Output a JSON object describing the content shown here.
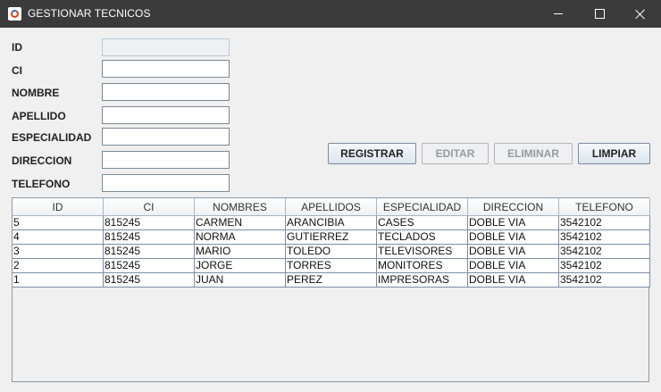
{
  "window": {
    "title": "GESTIONAR TECNICOS"
  },
  "form": {
    "labels": [
      "ID",
      "CI",
      "NOMBRE",
      "APELLIDO",
      "ESPECIALIDAD",
      "DIRECCION",
      "TELEFONO"
    ],
    "values": {
      "id": "",
      "ci": "",
      "nombre": "",
      "apellido": "",
      "especialidad": "",
      "direccion": "",
      "telefono": ""
    }
  },
  "buttons": {
    "registrar": "REGISTRAR",
    "editar": "EDITAR",
    "eliminar": "ELIMINAR",
    "limpiar": "LIMPIAR"
  },
  "table": {
    "columns": [
      "ID",
      "CI",
      "NOMBRES",
      "APELLIDOS",
      "ESPECIALIDAD",
      "DIRECCION",
      "TELEFONO"
    ],
    "rows": [
      [
        "5",
        "815245",
        "CARMEN",
        "ARANCIBIA",
        "CASES",
        "DOBLE VIA",
        "3542102"
      ],
      [
        "4",
        "815245",
        "NORMA",
        "GUTIERREZ",
        "TECLADOS",
        "DOBLE VIA",
        "3542102"
      ],
      [
        "3",
        "815245",
        "MARIO",
        "TOLEDO",
        "TELEVISORES",
        "DOBLE VIA",
        "3542102"
      ],
      [
        "2",
        "815245",
        "JORGE",
        "TORRES",
        "MONITORES",
        "DOBLE VIA",
        "3542102"
      ],
      [
        "1",
        "815245",
        "JUAN",
        "PEREZ",
        "IMPRESORAS",
        "DOBLE VIA",
        "3542102"
      ]
    ]
  }
}
